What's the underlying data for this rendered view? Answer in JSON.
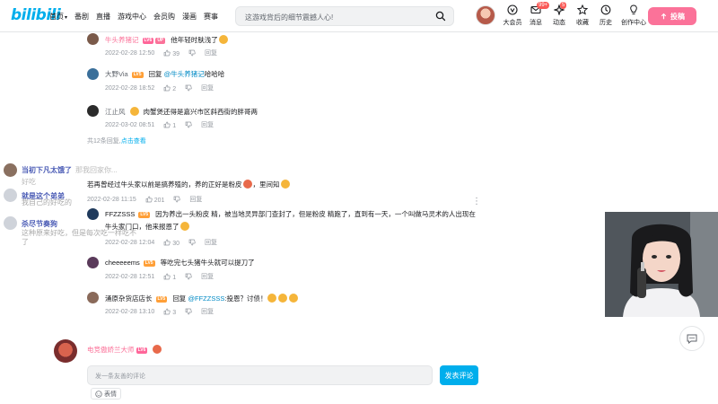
{
  "nav": {
    "logo": "bilibili",
    "items": [
      "首页",
      "番剧",
      "直播",
      "游戏中心",
      "会员购",
      "漫画",
      "赛事"
    ]
  },
  "search": {
    "placeholder": "这游戏背后的细节震撼人心!"
  },
  "top_icons": [
    {
      "icon": "vip-icon",
      "label": "大会员",
      "badge": ""
    },
    {
      "icon": "message-icon",
      "label": "消息",
      "badge": "99+"
    },
    {
      "icon": "dynamic-icon",
      "label": "动态",
      "badge": "5"
    },
    {
      "icon": "star-icon",
      "label": "收藏",
      "badge": ""
    },
    {
      "icon": "history-icon",
      "label": "历史",
      "badge": ""
    },
    {
      "icon": "lightbulb-icon",
      "label": "创作中心",
      "badge": ""
    }
  ],
  "upload_label": "投稿",
  "replies": [
    {
      "name": "牛头养猪记",
      "level": "LV6",
      "up": "UP",
      "text": "他年轻时肤浅了",
      "at": "",
      "time": "2022-02-28 12:50",
      "likes": "39",
      "reply": "回复",
      "avatar_color": "#7a5a4a"
    },
    {
      "name": "大野Via",
      "level": "LV5",
      "up": "",
      "text": "哈哈哈",
      "at": "@牛头养猪记",
      "reply_prefix": "回复",
      "time": "2022-02-28 18:52",
      "likes": "2",
      "reply": "回复",
      "avatar_color": "#3a6f9a"
    },
    {
      "name": "江止风",
      "level": "",
      "up": "",
      "text": "肉蟹煲还得是嘉兴市区斜西街的胖哥两",
      "at": "",
      "time": "2022-03-02 08:51",
      "likes": "1",
      "reply": "回复",
      "avatar_color": "#2b2b2b"
    }
  ],
  "more_replies": {
    "count_text": "共12条回复,",
    "link": "点击查看"
  },
  "main_comment": {
    "text": "若再曾经过牛头家以前是搞养殖的，养的正好是粉皮",
    "suffix": "，里间知",
    "time": "2022-02-28 11:15",
    "likes": "201",
    "reply": "回复"
  },
  "sub_replies": [
    {
      "name": "FFZZSSS",
      "level": "LV5",
      "text": "因为养出一头粉皮 精，被当地灵异部门查封了，但是粉皮 精跑了，直到有一天，一个叫做马灵术的人出现在牛头家门口，他来报恩了",
      "time": "2022-02-28 12:04",
      "likes": "30",
      "reply": "回复",
      "avatar_color": "#1f3a5c"
    },
    {
      "name": "cheeeeems",
      "level": "LV5",
      "text": "等吃完七头猪牛头就可以提刀了",
      "time": "2022-02-28 12:51",
      "likes": "1",
      "reply": "回复",
      "avatar_color": "#5a3a5a"
    },
    {
      "name": "涌原杂货店店长",
      "level": "LV5",
      "text": ":投恩？讨债！",
      "at": "@FFZZSSS",
      "reply_prefix": "回复",
      "time": "2022-02-28 13:10",
      "likes": "3",
      "reply": "回复",
      "avatar_color": "#8a6a5a"
    }
  ],
  "root_comment": {
    "name": "电竞傲娇兰大师",
    "level": "LV6"
  },
  "danmaku": [
    {
      "name": "当初下凡太饿了",
      "text": "那我回家你..."
    },
    {
      "name": "好吃",
      "text": ""
    },
    {
      "name": "就是这个弟弟",
      "text": "我自己的好吃的"
    },
    {
      "name": "杀尽节奏狗",
      "text": "这种原来好吃，但是每次吃一样吃不了"
    }
  ],
  "comment_box": {
    "placeholder": "发一条友善的评论",
    "send": "发表评论",
    "emoji": "表情"
  }
}
